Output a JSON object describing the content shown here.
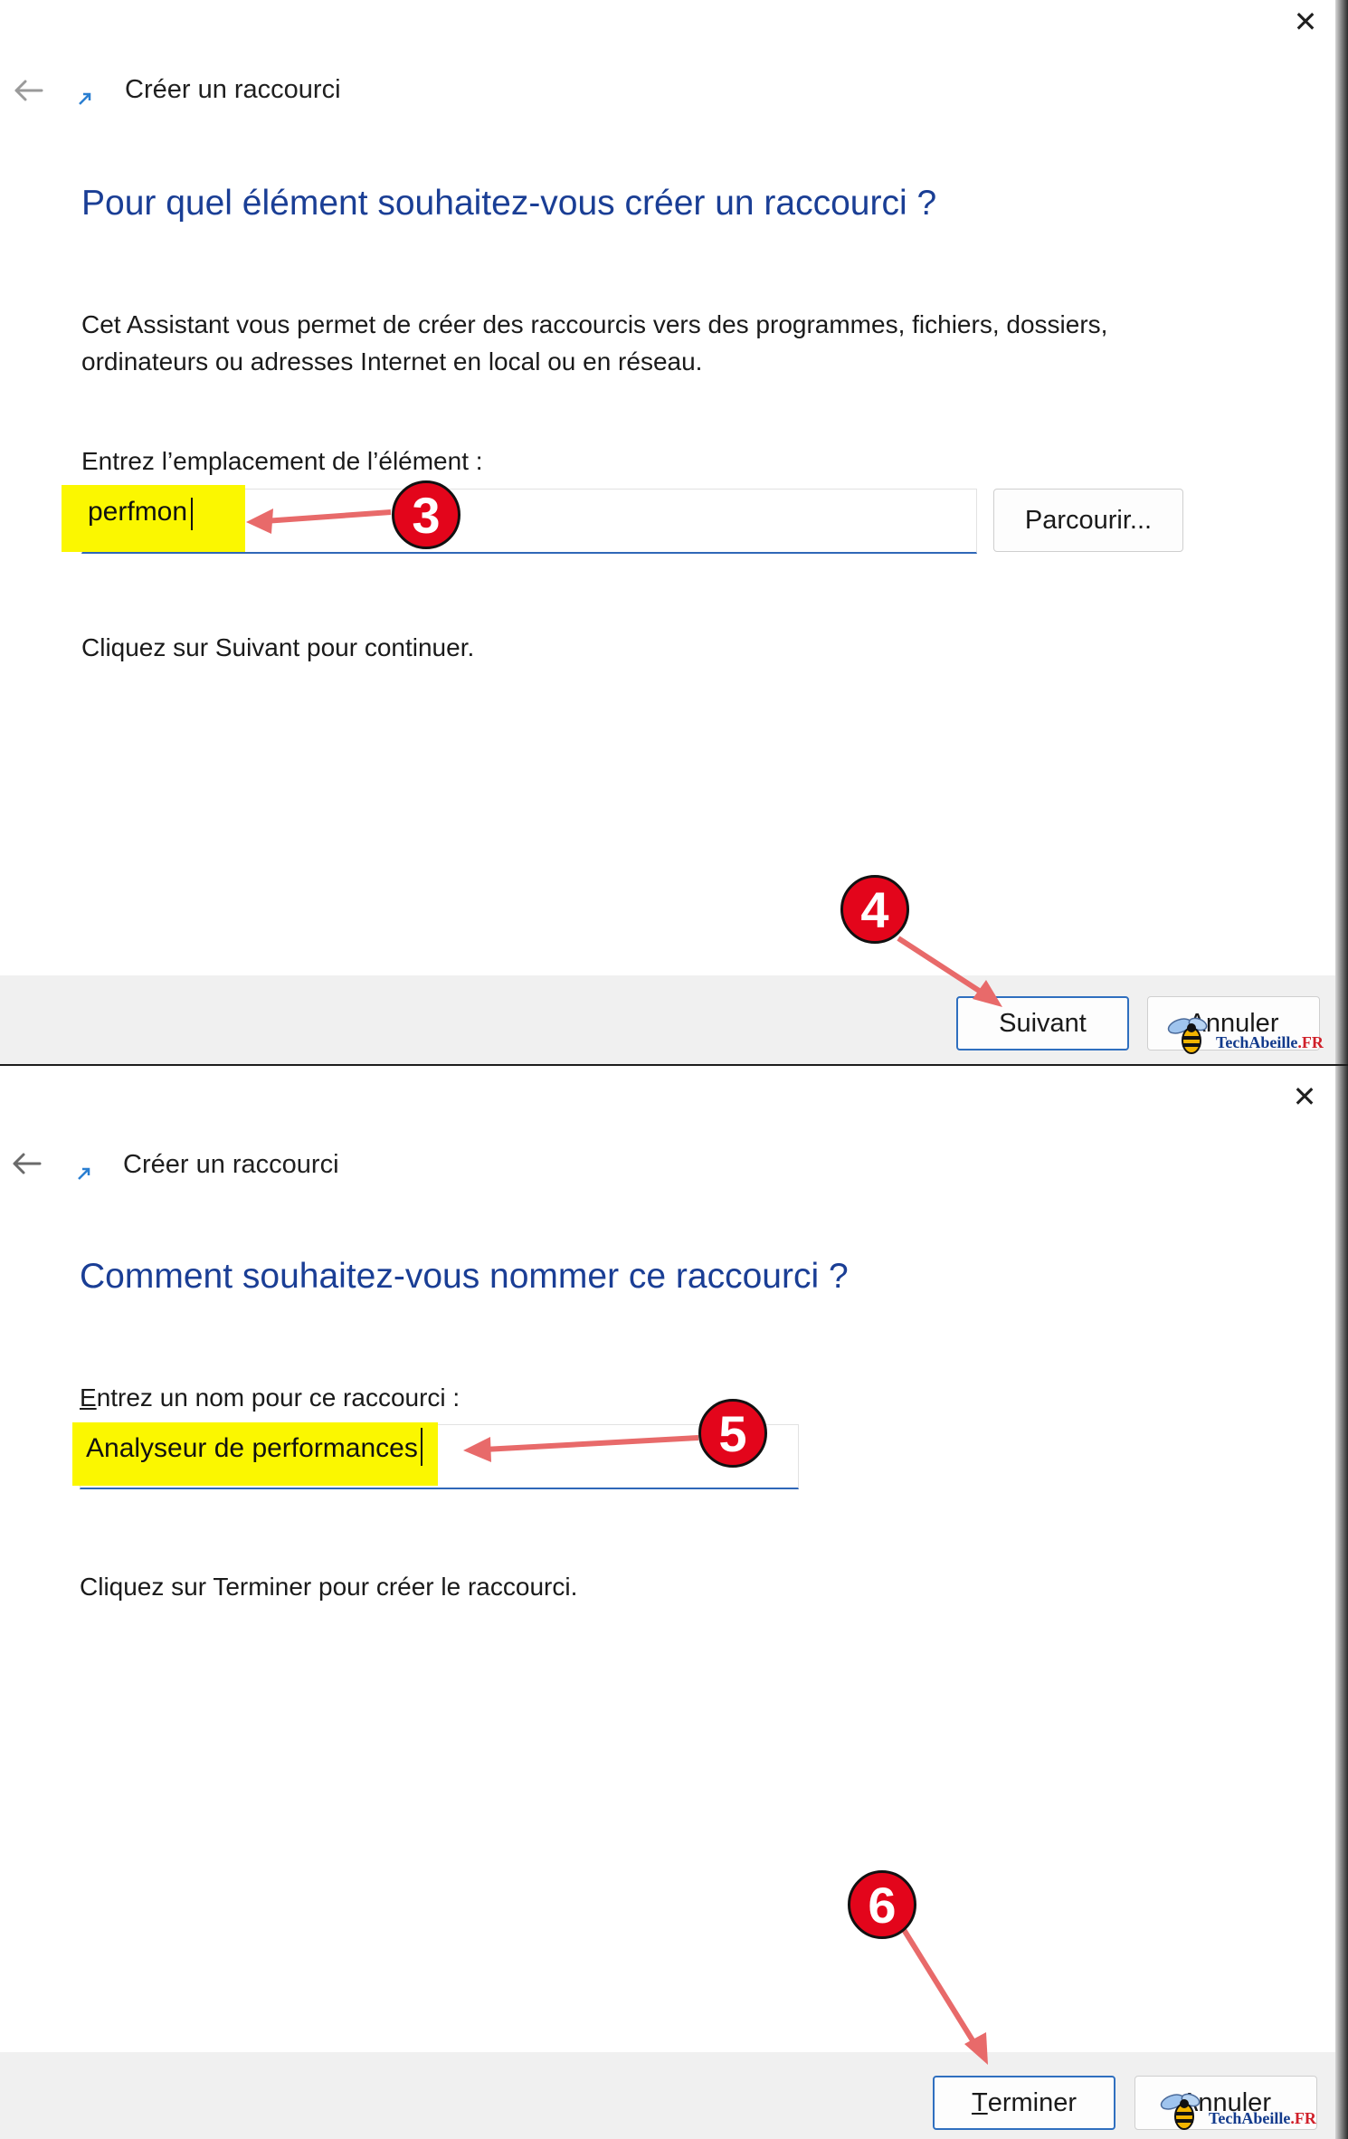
{
  "dialog1": {
    "window_title": "Créer un raccourci",
    "heading": "Pour quel élément souhaitez-vous créer un raccourci ?",
    "description": "Cet Assistant vous permet de créer des raccourcis vers des programmes, fichiers, dossiers, ordinateurs ou adresses Internet en local ou en réseau.",
    "location_label": "Entrez l’emplacement de l’élément :",
    "location_value": "perfmon",
    "browse_label": "Parcourir...",
    "hint": "Cliquez sur Suivant pour continuer.",
    "next_label": "Suivant",
    "cancel_label": "Annuler"
  },
  "dialog2": {
    "window_title": "Créer un raccourci",
    "heading": "Comment souhaitez-vous nommer ce raccourci ?",
    "name_label_first": "E",
    "name_label_rest": "ntrez un nom pour ce raccourci :",
    "name_value": "Analyseur de performances",
    "hint": "Cliquez sur Terminer pour créer le raccourci.",
    "finish_label_first": "T",
    "finish_label_rest": "erminer",
    "cancel_label": "Annuler"
  },
  "annotations": {
    "step3": "3",
    "step4": "4",
    "step5": "5",
    "step6": "6"
  },
  "watermark": {
    "brand": "TechAbeille",
    "dot": ".",
    "tld": "FR"
  },
  "colors": {
    "heading": "#1a3e95",
    "accent": "#2f6fbf",
    "highlight": "#fbf700",
    "badge": "#e3051b",
    "arrow": "#e86a6a",
    "footer": "#f0f0f0"
  },
  "icons": {
    "close": "close-icon",
    "back": "back-arrow-icon",
    "app": "shortcut-arrow-icon"
  }
}
